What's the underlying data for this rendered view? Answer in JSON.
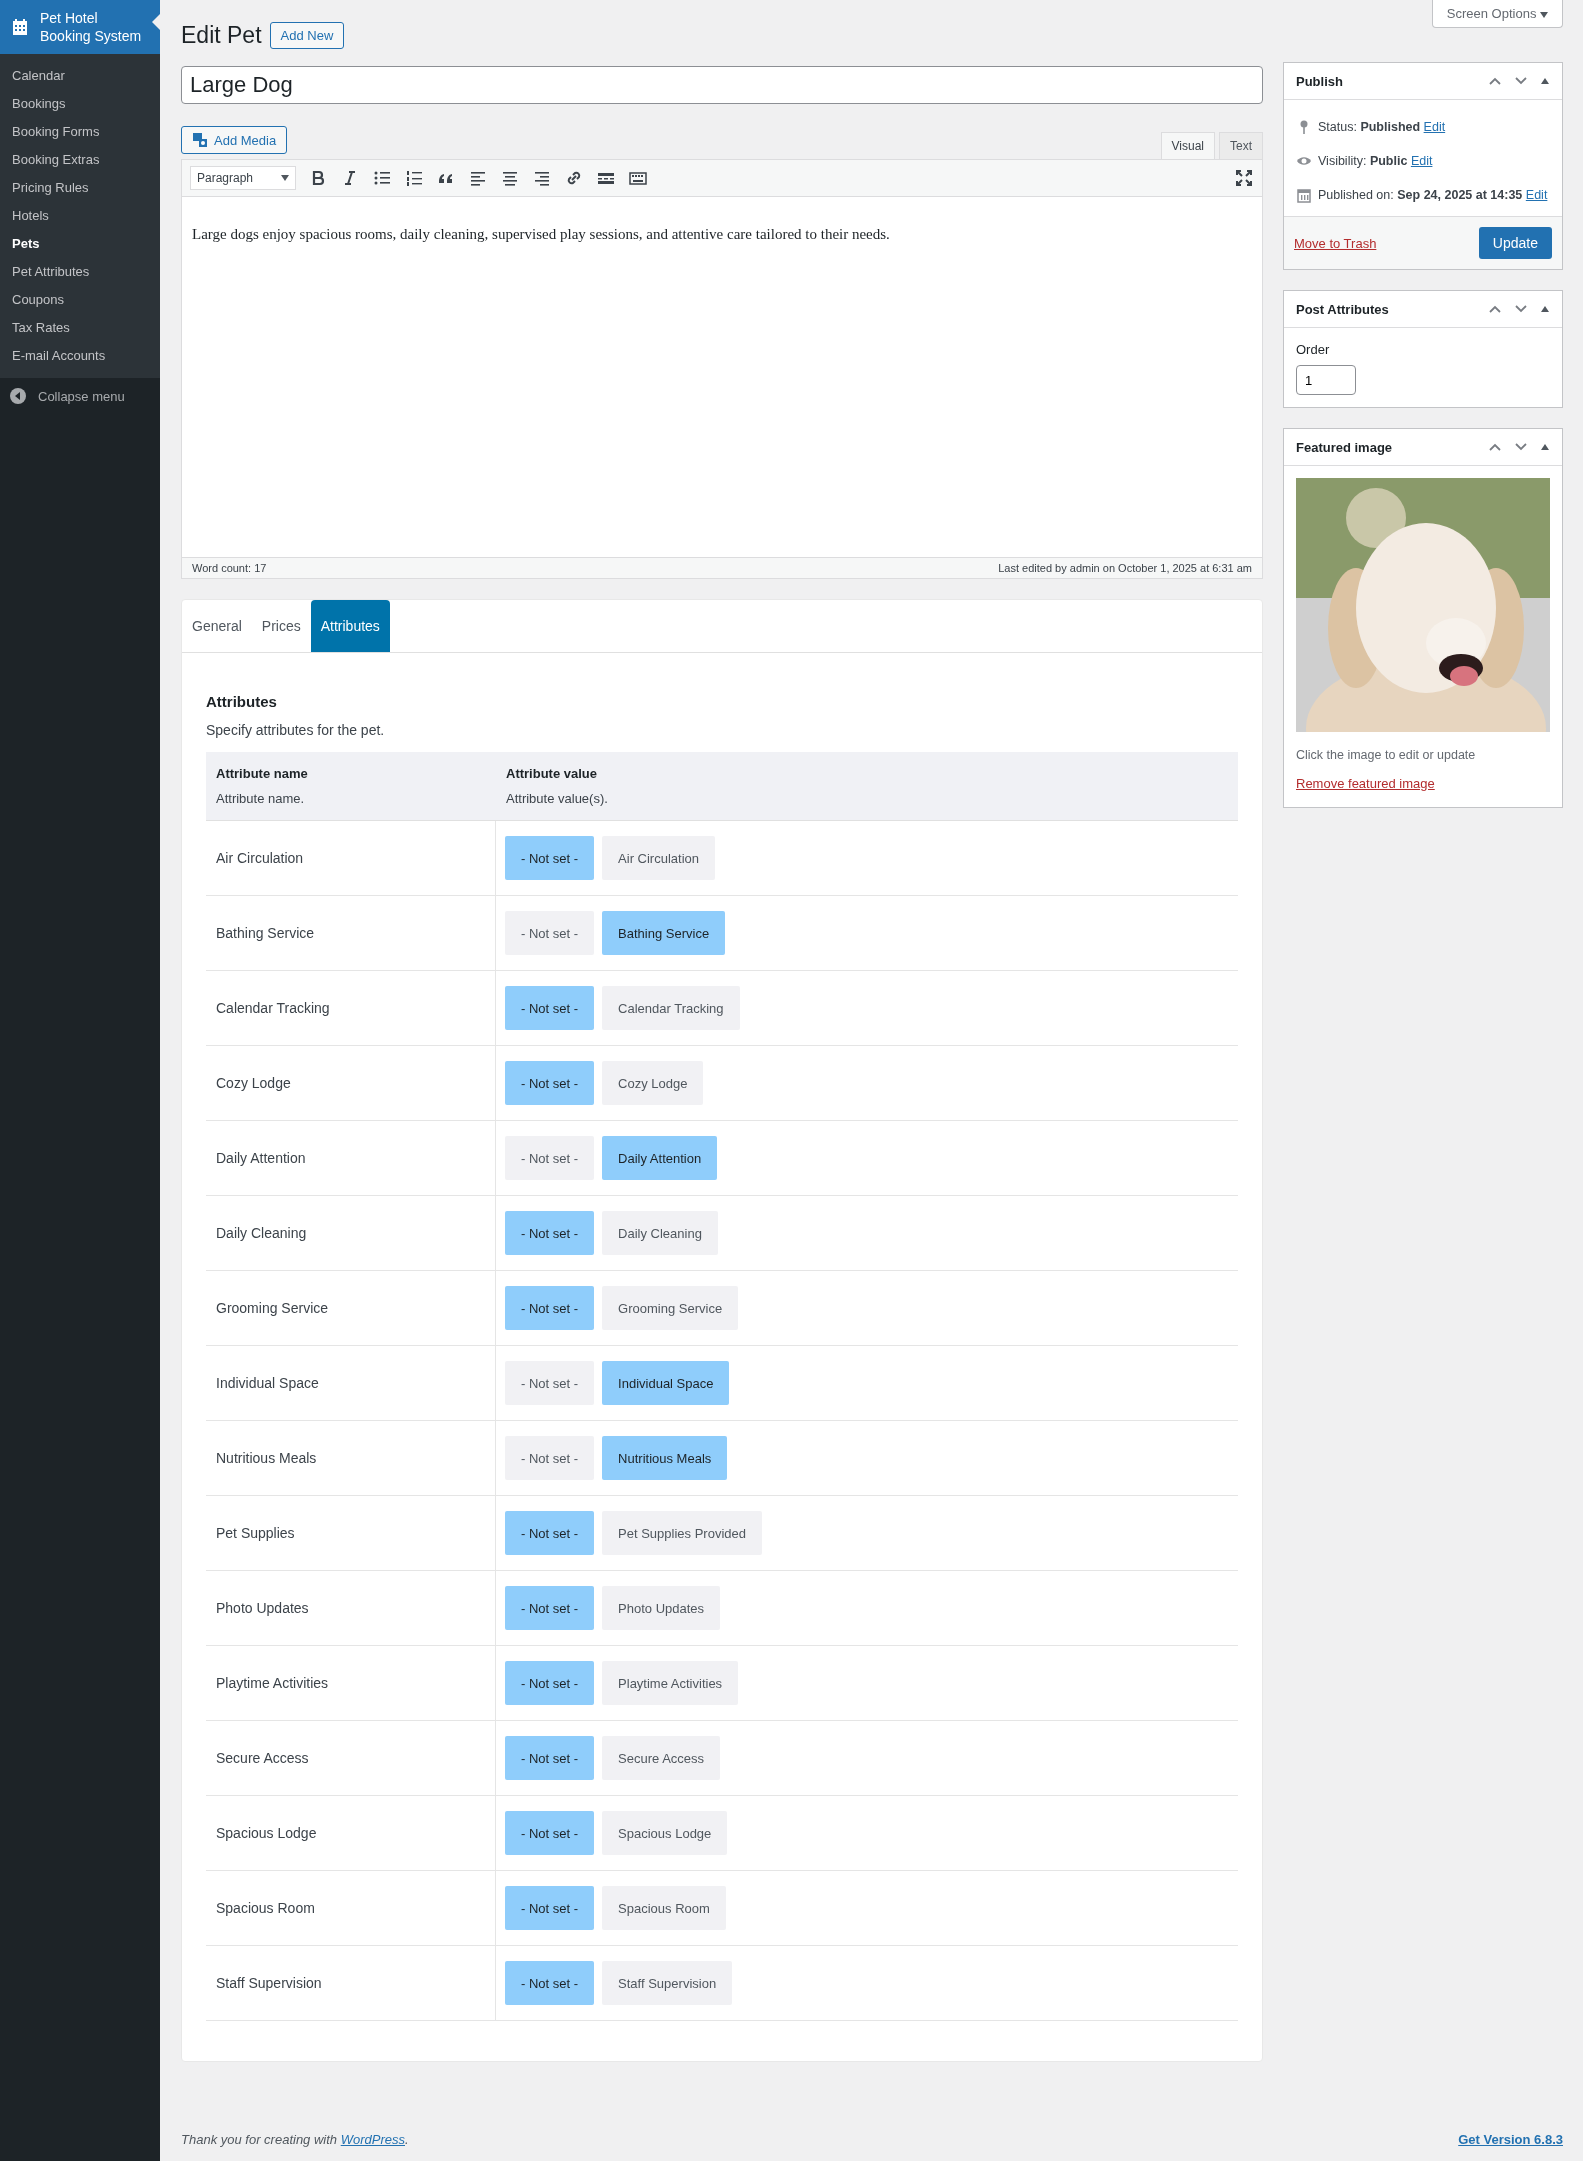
{
  "sidebar": {
    "brand": "Pet Hotel Booking System",
    "items": [
      {
        "label": "Calendar",
        "selected": false
      },
      {
        "label": "Bookings",
        "selected": false
      },
      {
        "label": "Booking Forms",
        "selected": false
      },
      {
        "label": "Booking Extras",
        "selected": false
      },
      {
        "label": "Pricing Rules",
        "selected": false
      },
      {
        "label": "Hotels",
        "selected": false
      },
      {
        "label": "Pets",
        "selected": true
      },
      {
        "label": "Pet Attributes",
        "selected": false
      },
      {
        "label": "Coupons",
        "selected": false
      },
      {
        "label": "Tax Rates",
        "selected": false
      },
      {
        "label": "E-mail Accounts",
        "selected": false
      }
    ],
    "collapse": "Collapse menu"
  },
  "screen_options": "Screen Options",
  "heading": "Edit Pet",
  "add_new": "Add New",
  "post_title": "Large Dog",
  "editor": {
    "add_media": "Add Media",
    "modes": [
      {
        "label": "Visual",
        "selected": true
      },
      {
        "label": "Text",
        "selected": false
      }
    ],
    "format": "Paragraph",
    "content": "Large dogs enjoy spacious rooms, daily cleaning, supervised play sessions, and attentive care tailored to their needs.",
    "word_count": "Word count: 17",
    "last_edited": "Last edited by admin on October 1, 2025 at 6:31 am"
  },
  "tabs": [
    {
      "label": "General",
      "selected": false
    },
    {
      "label": "Prices",
      "selected": false
    },
    {
      "label": "Attributes",
      "selected": true
    }
  ],
  "attributes": {
    "title": "Attributes",
    "description": "Specify attributes for the pet.",
    "columns": [
      {
        "title": "Attribute name",
        "hint": "Attribute name."
      },
      {
        "title": "Attribute value",
        "hint": "Attribute value(s)."
      }
    ],
    "rows": [
      {
        "name": "Air Circulation",
        "options": [
          {
            "label": "- Not set -",
            "selected": true
          },
          {
            "label": "Air Circulation",
            "selected": false
          }
        ]
      },
      {
        "name": "Bathing Service",
        "options": [
          {
            "label": "- Not set -",
            "selected": false
          },
          {
            "label": "Bathing Service",
            "selected": true
          }
        ]
      },
      {
        "name": "Calendar Tracking",
        "options": [
          {
            "label": "- Not set -",
            "selected": true
          },
          {
            "label": "Calendar Tracking",
            "selected": false
          }
        ]
      },
      {
        "name": "Cozy Lodge",
        "options": [
          {
            "label": "- Not set -",
            "selected": true
          },
          {
            "label": "Cozy Lodge",
            "selected": false
          }
        ]
      },
      {
        "name": "Daily Attention",
        "options": [
          {
            "label": "- Not set -",
            "selected": false
          },
          {
            "label": "Daily Attention",
            "selected": true
          }
        ]
      },
      {
        "name": "Daily Cleaning",
        "options": [
          {
            "label": "- Not set -",
            "selected": true
          },
          {
            "label": "Daily Cleaning",
            "selected": false
          }
        ]
      },
      {
        "name": "Grooming Service",
        "options": [
          {
            "label": "- Not set -",
            "selected": true
          },
          {
            "label": "Grooming Service",
            "selected": false
          }
        ]
      },
      {
        "name": "Individual Space",
        "options": [
          {
            "label": "- Not set -",
            "selected": false
          },
          {
            "label": "Individual Space",
            "selected": true
          }
        ]
      },
      {
        "name": "Nutritious Meals",
        "options": [
          {
            "label": "- Not set -",
            "selected": false
          },
          {
            "label": "Nutritious Meals",
            "selected": true
          }
        ]
      },
      {
        "name": "Pet Supplies",
        "options": [
          {
            "label": "- Not set -",
            "selected": true
          },
          {
            "label": "Pet Supplies Provided",
            "selected": false
          }
        ]
      },
      {
        "name": "Photo Updates",
        "options": [
          {
            "label": "- Not set -",
            "selected": true
          },
          {
            "label": "Photo Updates",
            "selected": false
          }
        ]
      },
      {
        "name": "Playtime Activities",
        "options": [
          {
            "label": "- Not set -",
            "selected": true
          },
          {
            "label": "Playtime Activities",
            "selected": false
          }
        ]
      },
      {
        "name": "Secure Access",
        "options": [
          {
            "label": "- Not set -",
            "selected": true
          },
          {
            "label": "Secure Access",
            "selected": false
          }
        ]
      },
      {
        "name": "Spacious Lodge",
        "options": [
          {
            "label": "- Not set -",
            "selected": true
          },
          {
            "label": "Spacious Lodge",
            "selected": false
          }
        ]
      },
      {
        "name": "Spacious Room",
        "options": [
          {
            "label": "- Not set -",
            "selected": true
          },
          {
            "label": "Spacious Room",
            "selected": false
          }
        ]
      },
      {
        "name": "Staff Supervision",
        "options": [
          {
            "label": "- Not set -",
            "selected": true
          },
          {
            "label": "Staff Supervision",
            "selected": false
          }
        ]
      }
    ]
  },
  "publish": {
    "title": "Publish",
    "lines": [
      {
        "kind": "status",
        "text": "Status: **Published**",
        "link": "Edit"
      },
      {
        "kind": "visibility",
        "text": "Visibility: **Public**",
        "link": "Edit"
      },
      {
        "kind": "date",
        "text": "Published on: **Sep 24, 2025 at 14:35**",
        "link": "Edit"
      }
    ],
    "trash": "Move to Trash",
    "update": "Update"
  },
  "post_attributes": {
    "title": "Post Attributes",
    "order_label": "Order",
    "order": "1"
  },
  "featured_image": {
    "title": "Featured image",
    "hint": "Click the image to edit or update",
    "remove": "Remove featured image"
  },
  "footer": {
    "before": "Thank you for creating with ",
    "link": "WordPress",
    "after": ".",
    "version": "Get Version 6.8.3"
  }
}
